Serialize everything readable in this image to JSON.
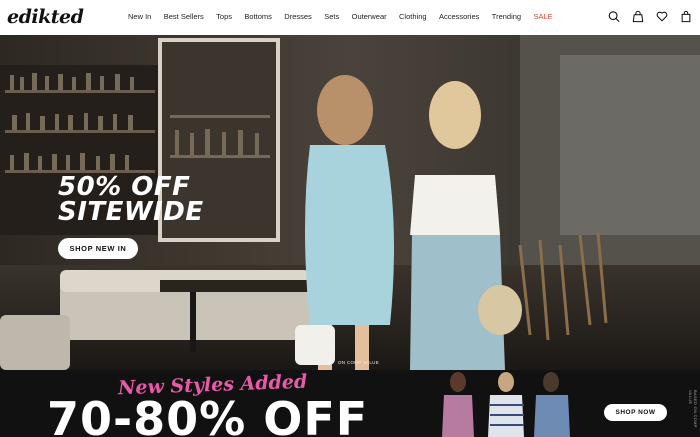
{
  "brand": {
    "logo_text": "edikted"
  },
  "nav": {
    "items": [
      {
        "label": "New In"
      },
      {
        "label": "Best Sellers"
      },
      {
        "label": "Tops"
      },
      {
        "label": "Bottoms"
      },
      {
        "label": "Dresses"
      },
      {
        "label": "Sets"
      },
      {
        "label": "Outerwear"
      },
      {
        "label": "Clothing"
      },
      {
        "label": "Accessories"
      },
      {
        "label": "Trending"
      },
      {
        "label": "SALE"
      }
    ]
  },
  "header_icons": [
    "search-icon",
    "account-icon",
    "heart-icon",
    "bag-icon"
  ],
  "hero": {
    "headline_line1": "50% OFF",
    "headline_line2": "SITEWIDE",
    "button_label": "SHOP NEW IN",
    "disclaimer": "ON COMP VALUE"
  },
  "promo": {
    "script_text": "New Styles Added",
    "headline": "70-80% OFF",
    "button_label": "SHOP NOW",
    "side_text": "BASED ON COMP VALUE"
  },
  "colors": {
    "sale": "#e0453a",
    "promo_script": "#e85aa8",
    "promo_bg": "#111111"
  }
}
